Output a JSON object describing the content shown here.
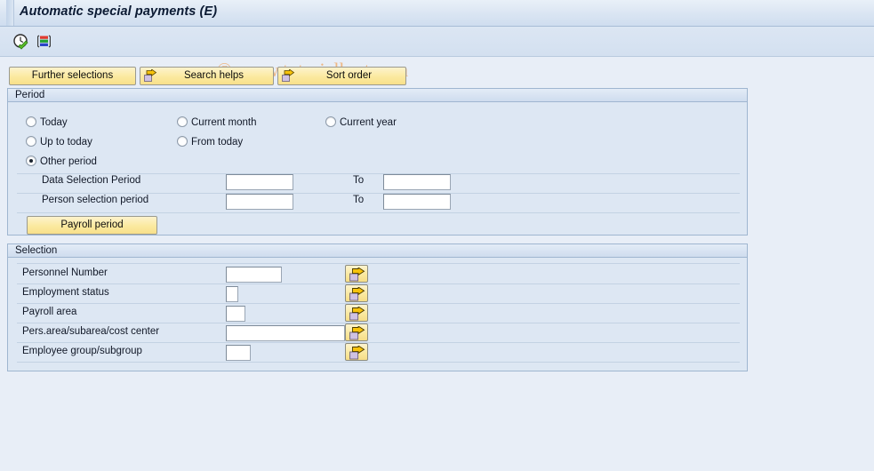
{
  "window": {
    "title": "Automatic special payments (E)"
  },
  "toolbar": {
    "icons": [
      {
        "name": "execute-clock-icon",
        "label": "Execute"
      },
      {
        "name": "variant-bars-icon",
        "label": "Get variant"
      }
    ]
  },
  "watermark": {
    "text": "© www.tutorialkart.com"
  },
  "buttons": {
    "further_selections": "Further selections",
    "search_helps": "Search helps",
    "sort_order": "Sort order"
  },
  "period": {
    "group_title": "Period",
    "radios": [
      {
        "label": "Today",
        "checked": false
      },
      {
        "label": "Current month",
        "checked": false
      },
      {
        "label": "Current year",
        "checked": false
      },
      {
        "label": "Up to today",
        "checked": false
      },
      {
        "label": "From today",
        "checked": false
      },
      {
        "label": "Other period",
        "checked": true
      }
    ],
    "rows": [
      {
        "label": "Data Selection Period",
        "value": "",
        "to_label": "To",
        "to_value": ""
      },
      {
        "label": "Person selection period",
        "value": "",
        "to_label": "To",
        "to_value": ""
      }
    ],
    "payroll_button": "Payroll period"
  },
  "selection": {
    "group_title": "Selection",
    "rows": [
      {
        "label": "Personnel Number",
        "value": ""
      },
      {
        "label": "Employment status",
        "value": ""
      },
      {
        "label": "Payroll area",
        "value": ""
      },
      {
        "label": "Pers.area/subarea/cost center",
        "value": ""
      },
      {
        "label": "Employee group/subgroup",
        "value": ""
      }
    ],
    "multi_select_icon": "multi-select-arrow-icon"
  },
  "colors": {
    "app_background": "#e8eef7",
    "group_background": "#dde7f3",
    "button_yellow": "#fbe99f",
    "watermark": "#eeb784",
    "title_text": "#0b1a33"
  }
}
